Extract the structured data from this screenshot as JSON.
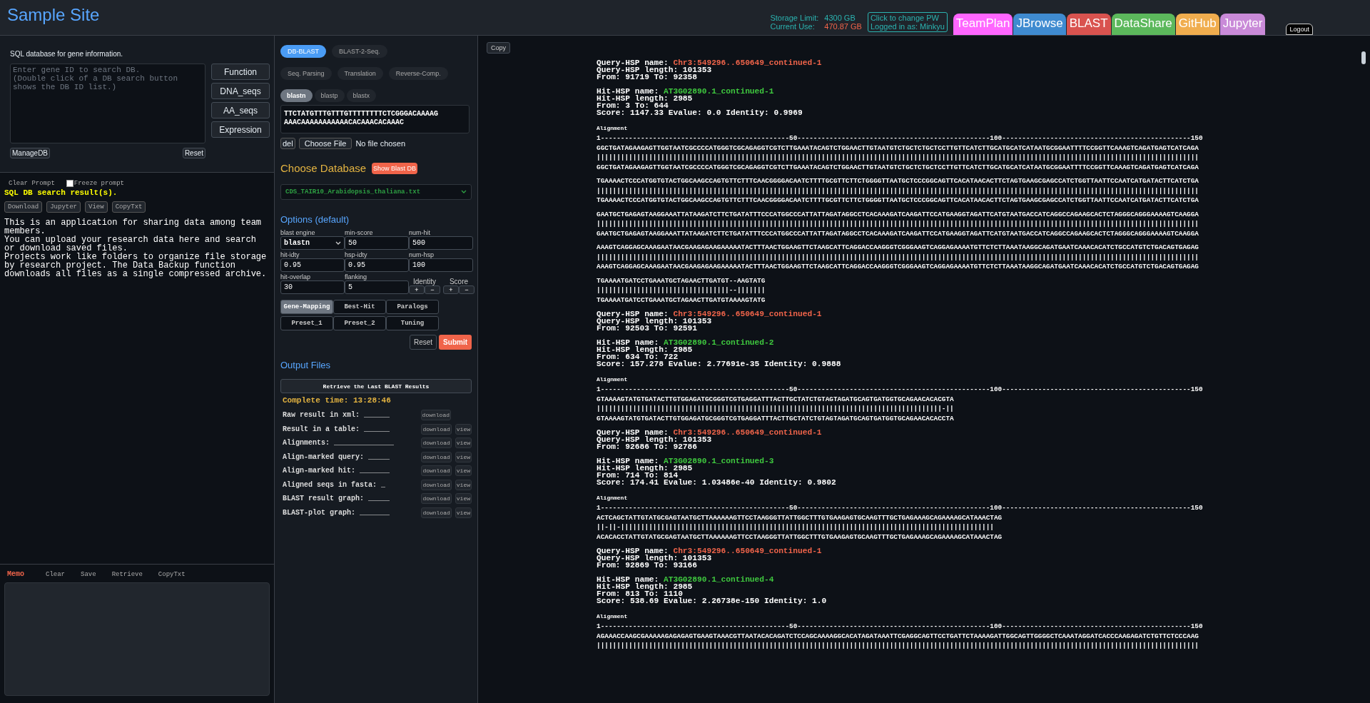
{
  "header": {
    "title": "Sample Site",
    "storage": {
      "limit_label": "Storage Limit:",
      "limit_value": "4300 GB",
      "use_label": "Current Use:",
      "use_value": "470.87 GB"
    },
    "account": [
      "Click to change PW",
      "Logged in as: Minkyu"
    ],
    "nav_tabs": [
      {
        "label": "TeamPlan",
        "color": "#ff66ff"
      },
      {
        "label": "JBrowse",
        "color": "#3f8bd0"
      },
      {
        "label": "BLAST",
        "color": "#d9534f"
      },
      {
        "label": "DataShare",
        "color": "#5cb85c"
      },
      {
        "label": "GitHub",
        "color": "#f0ad4e"
      },
      {
        "label": "Jupyter",
        "color": "#c98ad8"
      }
    ],
    "logout": "Logout"
  },
  "left": {
    "db": {
      "description": "SQL database for gene information.",
      "placeholder": "Enter gene ID to search DB.\n(Double click of a DB search button shows the DB ID list.)",
      "buttons": [
        "Function",
        "DNA_seqs",
        "AA_seqs",
        "Expression"
      ],
      "manage_button": "ManageDB",
      "reset_button": "Reset"
    },
    "prompt": {
      "clear_label": "Clear Prompt",
      "freeze": {
        "label": "Freeze prompt",
        "checked": false
      },
      "result_title": "SQL DB search result(s).",
      "actions": [
        "Download",
        "Jupyter",
        "View",
        "CopyTxt"
      ],
      "message_lines": [
        "This is an application for sharing data among team members.",
        "You can upload your research data here and search or download saved files.",
        "Projects work like folders to organize file storage by research project. The Data Backup function downloads all files as a single compressed archive."
      ]
    },
    "memo": {
      "title": "Memo",
      "actions": [
        "Clear",
        "Save",
        "Retrieve",
        "CopyTxt"
      ]
    }
  },
  "middle": {
    "mode_tabs": [
      {
        "label": "DB-BLAST",
        "selected": true
      },
      {
        "label": "BLAST-2-Seq.",
        "selected": false
      }
    ],
    "tools": [
      "Seq. Parsing",
      "Translation",
      "Reverse-Comp."
    ],
    "programs": [
      {
        "label": "blastn",
        "selected": true
      },
      {
        "label": "blastp",
        "selected": false
      },
      {
        "label": "blastx",
        "selected": false
      }
    ],
    "sequence": "TTCTATGTTTGTTTGTTTTTTTTCTCGGGACAAAAG\nAAACAAAAAAAAAAACACAAACACAAAC",
    "delete_button": "del",
    "file_button": "Choose File",
    "file_status": "No file chosen",
    "database_title": "Choose Database",
    "show_db_button": "Show Blast DB",
    "database": "CDS_TAIR10_Arabidopsis_thaliana.txt",
    "options_title": "Options (default)",
    "options": [
      {
        "kind": "select",
        "label": "blast engine",
        "value": "blastn"
      },
      {
        "kind": "input",
        "label": "min-score",
        "value": "50"
      },
      {
        "kind": "input",
        "label": "num-hit",
        "value": "500"
      },
      {
        "kind": "input",
        "label": "hit-idty",
        "value": "0.95"
      },
      {
        "kind": "input",
        "label": "hsp-idty",
        "value": "0.95"
      },
      {
        "kind": "input",
        "label": "num-hsp",
        "value": "100"
      },
      {
        "kind": "input",
        "label": "hit-overlap",
        "value": "30"
      },
      {
        "kind": "input",
        "label": "flanking",
        "value": "5"
      },
      {
        "kind": "steppers",
        "groups": [
          {
            "label": "Identity",
            "buttons": [
              "+",
              "−"
            ]
          },
          {
            "label": "Score",
            "buttons": [
              "+",
              "−"
            ]
          }
        ]
      }
    ],
    "presets": [
      {
        "label": "Gene-Mapping",
        "selected": true
      },
      {
        "label": "Best-Hit",
        "selected": false
      },
      {
        "label": "Paralogs",
        "selected": false
      },
      {
        "label": "Preset_1",
        "selected": false
      },
      {
        "label": "Preset_2",
        "selected": false
      },
      {
        "label": "Tuning",
        "selected": false
      }
    ],
    "reset_button": "Reset",
    "submit_button": "Submit",
    "output_title": "Output Files",
    "retrieve_button": "Retrieve the Last BLAST Results",
    "complete_time": "Complete time: 13:28:46",
    "files": [
      {
        "label": "Raw result in xml:",
        "blank": "______",
        "actions": [
          "download"
        ]
      },
      {
        "label": "Result in a table:",
        "blank": "______",
        "actions": [
          "download",
          "view"
        ]
      },
      {
        "label": "Alignments:",
        "blank": "______________",
        "actions": [
          "download",
          "view"
        ]
      },
      {
        "label": "Align-marked query:",
        "blank": "_____",
        "actions": [
          "download",
          "view"
        ]
      },
      {
        "label": "Align-marked hit:",
        "blank": "_______",
        "actions": [
          "download",
          "view"
        ]
      },
      {
        "label": "Aligned seqs in fasta:",
        "blank": "_",
        "actions": [
          "download",
          "view"
        ]
      },
      {
        "label": "BLAST result graph:",
        "blank": "_____",
        "actions": [
          "download",
          "view"
        ]
      },
      {
        "label": "BLAST-plot graph:",
        "blank": "_______",
        "actions": [
          "download",
          "view"
        ]
      }
    ]
  },
  "results": {
    "copy_button": "Copy",
    "hsps": [
      {
        "query_name_label": "Query-HSP name:",
        "query_name": "Chr3:549296..650649_continued-1",
        "query_lines": [
          "Query-HSP length: 101353",
          "From: 91719 To: 92358"
        ],
        "hit_name_label": "Hit-HSP name:",
        "hit_name": "AT3G02890.1_continued-1",
        "hit_lines": [
          "Hit-HSP length: 2985",
          "From: 3 To: 644",
          "Score: 1147.33 Evalue: 0.0 Identity: 0.9969"
        ],
        "alignment_title": "Alignment",
        "ruler": "1-----------------------------------------------50------------------------------------------------100-----------------------------------------------150",
        "rows": [
          {
            "query": "GGCTGATAGAAGAGTTGGTAATCGCCCCATGGGTCGCAGAGGTCGTCTTGAAATACAGTCTGGAACTTGTAATGTCTGCTCTGCTCCTTGTTCATCTTGCATGCATCATAATGCGGAATTTTCCGGTTCAAAGTCAGATGAGTCATCAGA",
            "match": "||||||||||||||||||||||||||||||||||||||||||||||||||||||||||||||||||||||||||||||||||||||||||||||||||||||||||||||||||||||||||||||||||||||||||||||||||||||",
            "hit": "GGCTGATAGAAGAGTTGGTAATCGCCCCATGGGTCGCAGAGGTCGTCTTGAAATACAGTCTGGAACTTGTAATGTCTGCTCTGCTCCTTGTTCATCTTGCATGCATCATAATGCGGAATTTTCCGGTTCAAAGTCAGATGAGTCATCAGA"
          },
          {
            "query": "TGAAAACTCCCATGGTGTACTGGCAAGCCAGTGTTCTTTCAACGGGGACAATCTTTTGCGTTCTTCTGGGGTTAATGCTCCCGGCAGTTCACATAACACTTCTAGTGAAGCGAGCCATCTGGTTAATTCCAATCATGATACTTCATCTGA",
            "match": "||||||||||||||||||||||||||||||||||||||||||||||||||||||||||||||||||||||||||||||||||||||||||||||||||||||||||||||||||||||||||||||||||||||||||||||||||||||",
            "hit": "TGAAAACTCCCATGGTGTACTGGCAAGCCAGTGTTCTTTCAACGGGGACAATCTTTTGCGTTCTTCTGGGGTTAATGCTCCCGGCAGTTCACATAACACTTCTAGTGAAGCGAGCCATCTGGTTAATTCCAATCATGATACTTCATCTGA"
          },
          {
            "query": "GAATGCTGAGAGTAAGGAAATTATAAGATCTTCTGATATTTCCCATGGCCCATTATTAGATAGGCCTCACAAAGATCAAGATTCCATGAAGGTAGATTCATGTAATGACCATCAGGCCAGAAGCACTCTAGGGCAGGGAAAAGTCAAGGA",
            "match": "||||||||||||||||||||||||||||||||||||||||||||||||||||||||||||||||||||||||||||||||||||||||||||||||||||||||||||||||||||||||||||||||||||||||||||||||||||||",
            "hit": "GAATGCTGAGAGTAAGGAAATTATAAGATCTTCTGATATTTCCCATGGCCCATTATTAGATAGGCCTCACAAAGATCAAGATTCCATGAAGGTAGATTCATGTAATGACCATCAGGCCAGAAGCACTCTAGGGCAGGGAAAAGTCAAGGA"
          },
          {
            "query": "AAAGTCAGGAGCAAAGAATAACGAAGAGAAGAAAAATACTTTAACTGGAAGTTCTAAGCATTCAGGACCAAGGGTCGGGAAGTCAGGAGAAAATGTTCTCTTAAATAAGGCAGATGAATCAAACACATCTGCCATGTCTGACAGTGAGAG",
            "match": "||||||||||||||||||||||||||||||||||||||||||||||||||||||||||||||||||||||||||||||||||||||||||||||||||||||||||||||||||||||||||||||||||||||||||||||||||||||",
            "hit": "AAAGTCAGGAGCAAAGAATAACGAAGAGAAGAAAAATACTTTAACTGGAAGTTCTAAGCATTCAGGACCAAGGGTCGGGAAGTCAGGAGAAAATGTTCTCTTAAATAAGGCAGATGAATCAAACACATCTGCCATGTCTGACAGTGAGAG"
          },
          {
            "query": "TGAAAATGATCCTGAAATGCTAGAACTTGATGT--AAGTATG",
            "match": "|||||||||||||||||||||||||||||||||--|||||||",
            "hit": "TGAAAATGATCCTGAAATGCTAGAACTTGATGTAAAAGTATG"
          }
        ]
      },
      {
        "query_name_label": "Query-HSP name:",
        "query_name": "Chr3:549296..650649_continued-1",
        "query_lines": [
          "Query-HSP length: 101353",
          "From: 92503 To: 92591"
        ],
        "hit_name_label": "Hit-HSP name:",
        "hit_name": "AT3G02890.1_continued-2",
        "hit_lines": [
          "Hit-HSP length: 2985",
          "From: 634 To: 722",
          "Score: 157.278 Evalue: 2.77691e-35 Identity: 0.9888"
        ],
        "alignment_title": "Alignment",
        "ruler": "1-----------------------------------------------50------------------------------------------------100-----------------------------------------------150",
        "rows": [
          {
            "query": "GTAAAAGTATGTGATACTTGTGGAGATGCGGGTCGTGAGGATTTACTTGCTATCTGTAGTAGATGCAGTGATGGTGCAGAACACACGTA",
            "match": "||||||||||||||||||||||||||||||||||||||||||||||||||||||||||||||||||||||||||||||||||||||-||",
            "hit": "GTAAAAGTATGTGATACTTGTGGAGATGCGGGTCGTGAGGATTTACTTGCTATCTGTAGTAGATGCAGTGATGGTGCAGAACACACCTA"
          }
        ]
      },
      {
        "query_name_label": "Query-HSP name:",
        "query_name": "Chr3:549296..650649_continued-1",
        "query_lines": [
          "Query-HSP length: 101353",
          "From: 92686 To: 92786"
        ],
        "hit_name_label": "Hit-HSP name:",
        "hit_name": "AT3G02890.1_continued-3",
        "hit_lines": [
          "Hit-HSP length: 2985",
          "From: 714 To: 814",
          "Score: 174.41 Evalue: 1.03486e-40 Identity: 0.9802"
        ],
        "alignment_title": "Alignment",
        "ruler": "1-----------------------------------------------50------------------------------------------------100-----------------------------------------------150",
        "rows": [
          {
            "query": "ACTCAGCTATTGTATGCGAGTAATGCTTAAAAAAGTTCCTAAGGGTTATTGGCTTTGTGAAGAGTGCAAGTTTGCTGAGAAAGCAGAAAAGCATAAACTAG",
            "match": "||-||-|||||||||||||||||||||||||||||||||||||||||||||||||||||||||||||||||||||||||||||||||||||||||||||",
            "hit": "ACACACCTATTGTATGCGAGTAATGCTTAAAAAAGTTCCTAAGGGTTATTGGCTTTGTGAAGAGTGCAAGTTTGCTGAGAAAGCAGAAAAGCATAAACTAG"
          }
        ]
      },
      {
        "query_name_label": "Query-HSP name:",
        "query_name": "Chr3:549296..650649_continued-1",
        "query_lines": [
          "Query-HSP length: 101353",
          "From: 92869 To: 93166"
        ],
        "hit_name_label": "Hit-HSP name:",
        "hit_name": "AT3G02890.1_continued-4",
        "hit_lines": [
          "Hit-HSP length: 2985",
          "From: 813 To: 1110",
          "Score: 538.69 Evalue: 2.26738e-150 Identity: 1.0"
        ],
        "alignment_title": "Alignment",
        "ruler": "1-----------------------------------------------50------------------------------------------------100-----------------------------------------------150",
        "rows": [
          {
            "query": "AGAAACCAAGCGAAAAAGAGAGAGTGAAGTAAACGTTAATACACAGATCTCCAGCAAAAGGCACATAGATAAATTCGAGGCAGTTCCTGATTCTAAAAGATTGGCAGTTGGGGCTCAAATAGGATCACCCAAGAGATCTGTTCTCCCAAG",
            "match": "||||||||||||||||||||||||||||||||||||||||||||||||||||||||||||||||||||||||||||||||||||||||||||||||||||||||||||||||||||||||||||||||||||||||||||||||||||||"
          }
        ]
      }
    ]
  }
}
